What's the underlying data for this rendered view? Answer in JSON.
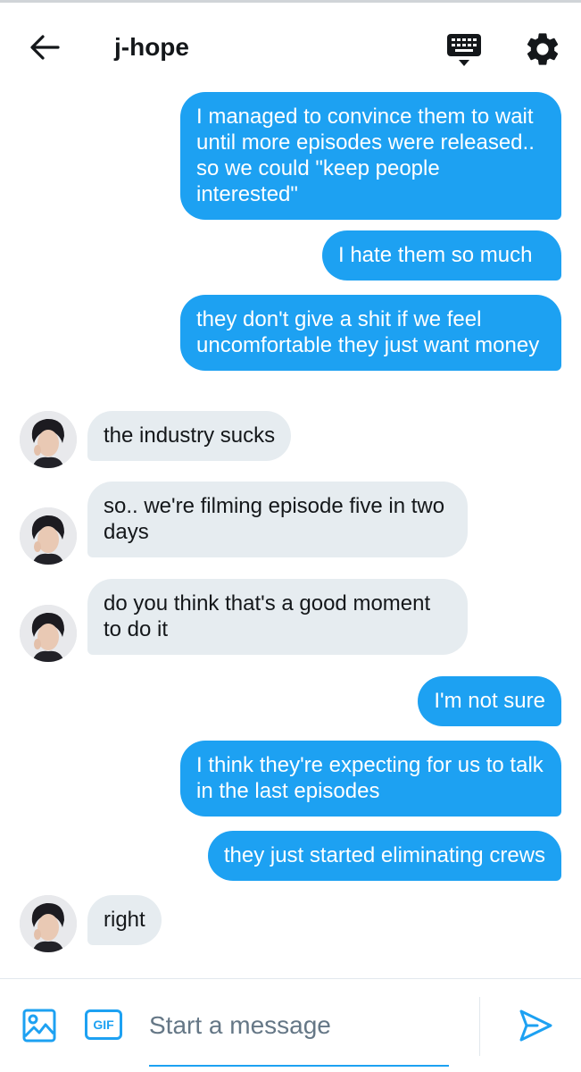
{
  "header": {
    "title": "j-hope",
    "icons": [
      "arrow-left-icon",
      "keyboard-icon",
      "gear-icon"
    ]
  },
  "colors": {
    "accent": "#1da1f2",
    "incoming_bubble": "#e6ecf0",
    "text": "#14171a",
    "placeholder": "#657786"
  },
  "messages": [
    {
      "dir": "out",
      "text": "I managed to convince them to wait until more episodes were released.. so we could \"keep people interested\""
    },
    {
      "dir": "out",
      "text": "I hate them so much"
    },
    {
      "dir": "out",
      "text": "they don't give a shit if we feel uncomfortable they just want money"
    },
    {
      "dir": "in",
      "text": "the industry sucks"
    },
    {
      "dir": "in",
      "text": "so.. we're filming episode five in two days"
    },
    {
      "dir": "in",
      "text": "do you think that's a good moment to do it"
    },
    {
      "dir": "out",
      "text": "I'm not sure"
    },
    {
      "dir": "out",
      "text": "I think they're expecting for us to talk in the last episodes"
    },
    {
      "dir": "out",
      "text": "they just started eliminating crews"
    },
    {
      "dir": "in",
      "text": "right"
    }
  ],
  "composer": {
    "gif_label": "GIF",
    "placeholder": "Start a message",
    "icons": [
      "image-icon",
      "gif-icon",
      "send-icon"
    ]
  }
}
